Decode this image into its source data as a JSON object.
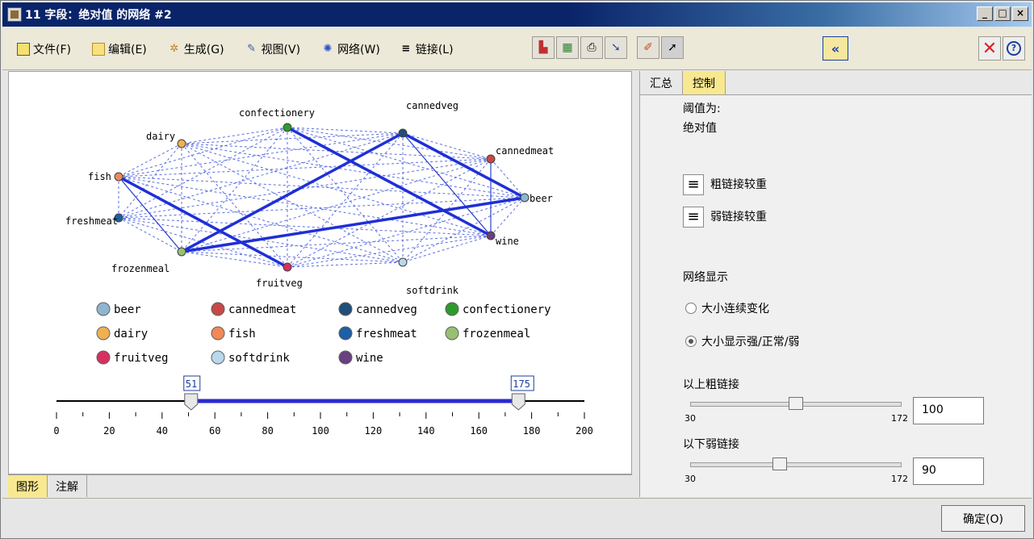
{
  "window": {
    "title": "11 字段：绝对值 的网络 #2"
  },
  "menu": [
    {
      "label": "文件(F)",
      "icon": "file-icon"
    },
    {
      "label": "编辑(E)",
      "icon": "edit-icon"
    },
    {
      "label": "生成(G)",
      "icon": "generate-icon"
    },
    {
      "label": "视图(V)",
      "icon": "view-icon"
    },
    {
      "label": "网络(W)",
      "icon": "network-icon"
    },
    {
      "label": "链接(L)",
      "icon": "links-icon"
    }
  ],
  "network": {
    "nodes": [
      {
        "name": "confectionery",
        "color": "#2e9a2e"
      },
      {
        "name": "cannedveg",
        "color": "#1f4e7a"
      },
      {
        "name": "dairy",
        "color": "#f0b050"
      },
      {
        "name": "cannedmeat",
        "color": "#c84848"
      },
      {
        "name": "fish",
        "color": "#f08858"
      },
      {
        "name": "beer",
        "color": "#8eb6d0"
      },
      {
        "name": "freshmeat",
        "color": "#1e5fa8"
      },
      {
        "name": "wine",
        "color": "#6a4080"
      },
      {
        "name": "frozenmeal",
        "color": "#98c070"
      },
      {
        "name": "fruitveg",
        "color": "#d83060"
      },
      {
        "name": "softdrink",
        "color": "#b8d8ec"
      }
    ],
    "strong_links": [
      [
        "confectionery",
        "wine"
      ],
      [
        "cannedveg",
        "frozenmeal"
      ],
      [
        "fish",
        "fruitveg"
      ],
      [
        "frozenmeal",
        "beer"
      ],
      [
        "cannedveg",
        "beer"
      ]
    ],
    "legend": [
      {
        "label": "beer",
        "color": "#8eb6d0"
      },
      {
        "label": "cannedmeat",
        "color": "#c84848"
      },
      {
        "label": "cannedveg",
        "color": "#1f4e7a"
      },
      {
        "label": "confectionery",
        "color": "#2e9a2e"
      },
      {
        "label": "dairy",
        "color": "#f0b050"
      },
      {
        "label": "fish",
        "color": "#f08858"
      },
      {
        "label": "freshmeat",
        "color": "#1e5fa8"
      },
      {
        "label": "frozenmeal",
        "color": "#98c070"
      },
      {
        "label": "fruitveg",
        "color": "#d83060"
      },
      {
        "label": "softdrink",
        "color": "#b8d8ec"
      },
      {
        "label": "wine",
        "color": "#6a4080"
      }
    ]
  },
  "range_slider": {
    "min": 0,
    "max": 200,
    "ticks": [
      "0",
      "20",
      "40",
      "60",
      "80",
      "100",
      "120",
      "140",
      "160",
      "180",
      "200"
    ],
    "low": 51,
    "high": 175,
    "low_label": "51",
    "high_label": "175"
  },
  "bottom_tabs": [
    "图形",
    "注解"
  ],
  "right_tabs": [
    "汇总",
    "控制"
  ],
  "controls": {
    "threshold_label": "阈值为:",
    "threshold_value": "绝对值",
    "heavy_label": "粗链接较重",
    "light_label": "弱链接较重",
    "display_label": "网络显示",
    "radio_continuous": "大小连续变化",
    "radio_strength": "大小显示强/正常/弱",
    "strong_above_label": "以上粗链接",
    "strong_min": "30",
    "strong_max": "172",
    "strong_value": "100",
    "weak_below_label": "以下弱链接",
    "weak_min": "30",
    "weak_max": "172",
    "weak_value": "90"
  },
  "ok_label": "确定(O)"
}
